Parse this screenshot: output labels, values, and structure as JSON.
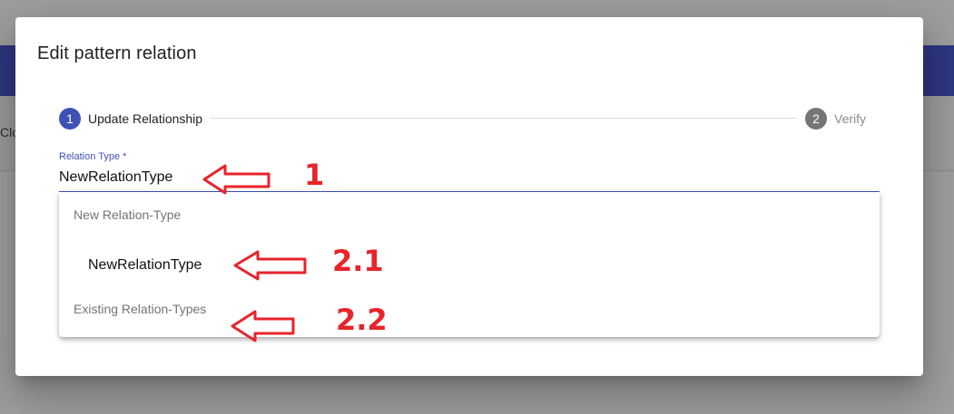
{
  "background": {
    "partial_text": "Clo"
  },
  "dialog": {
    "title": "Edit pattern relation"
  },
  "stepper": {
    "steps": [
      {
        "number": "1",
        "label": "Update Relationship",
        "state": "active"
      },
      {
        "number": "2",
        "label": "Verify",
        "state": "inactive"
      }
    ]
  },
  "field": {
    "label": "Relation Type",
    "required_marker": "*",
    "value": "NewRelationType"
  },
  "autocomplete": {
    "groups": [
      {
        "label": "New Relation-Type",
        "options": [
          "NewRelationType"
        ]
      },
      {
        "label": "Existing Relation-Types",
        "options": []
      }
    ]
  },
  "annotations": [
    {
      "label": "1",
      "color": "#e8232a"
    },
    {
      "label": "2.1",
      "color": "#e8232a"
    },
    {
      "label": "2.2",
      "color": "#e8232a"
    }
  ],
  "colors": {
    "primary": "#3f51b5",
    "inactive_step": "#757575",
    "annotation": "#e8232a"
  }
}
